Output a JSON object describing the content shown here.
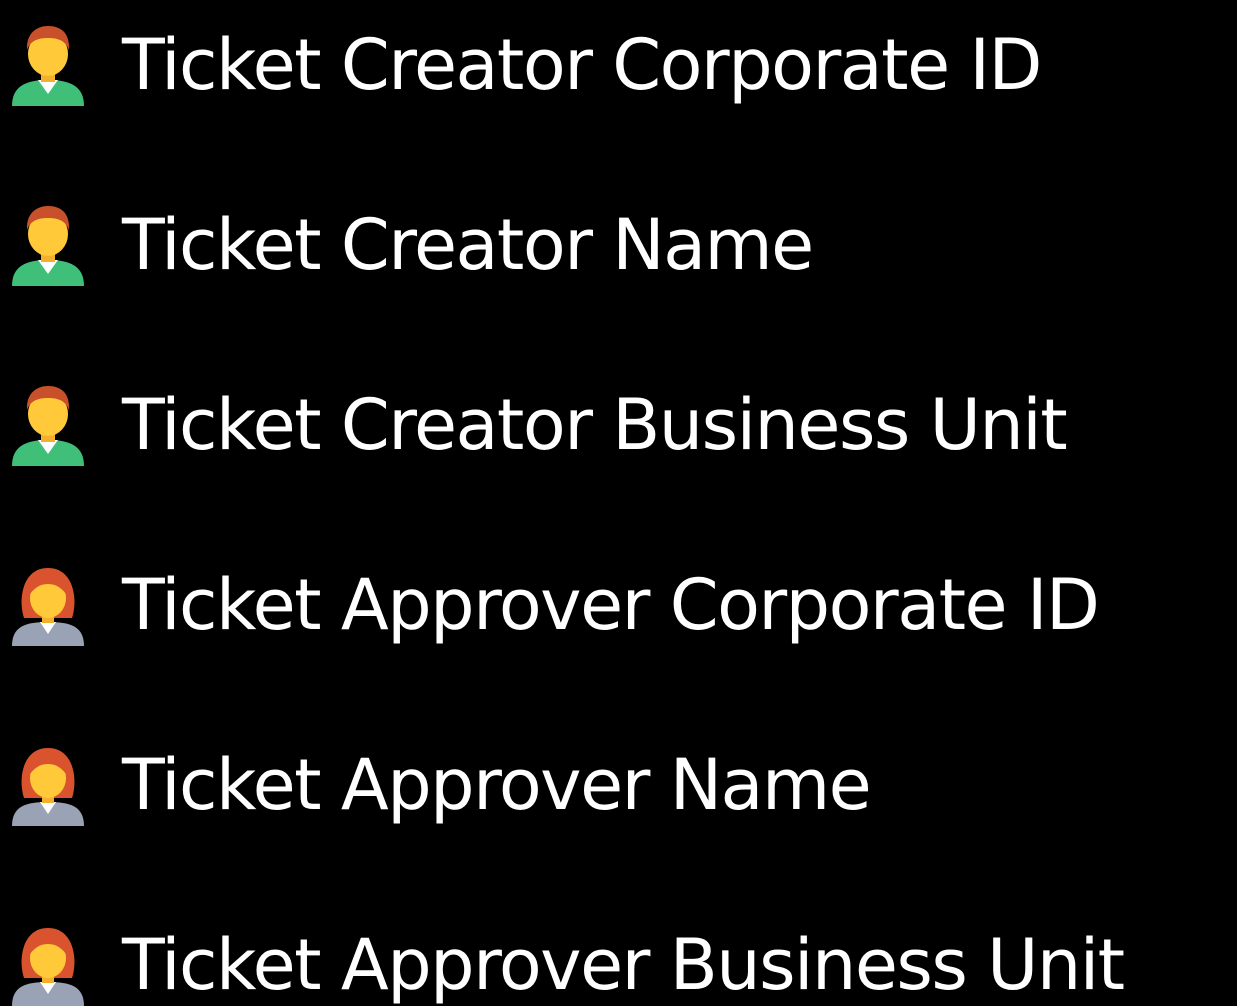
{
  "items": [
    {
      "label": "Ticket Creator Corporate ID",
      "icon": "man-icon"
    },
    {
      "label": "Ticket Creator Name",
      "icon": "man-icon"
    },
    {
      "label": "Ticket Creator Business Unit",
      "icon": "man-icon"
    },
    {
      "label": "Ticket Approver Corporate ID",
      "icon": "woman-icon"
    },
    {
      "label": "Ticket Approver Name",
      "icon": "woman-icon"
    },
    {
      "label": "Ticket Approver Business Unit",
      "icon": "woman-icon"
    }
  ],
  "colors": {
    "background": "#000000",
    "text": "#ffffff",
    "man_shirt": "#3fbf78",
    "man_skin": "#ffc93a",
    "man_hair": "#c8512b",
    "woman_shirt": "#9aa3b5",
    "woman_skin": "#ffc93a",
    "woman_hair": "#d9542e"
  }
}
